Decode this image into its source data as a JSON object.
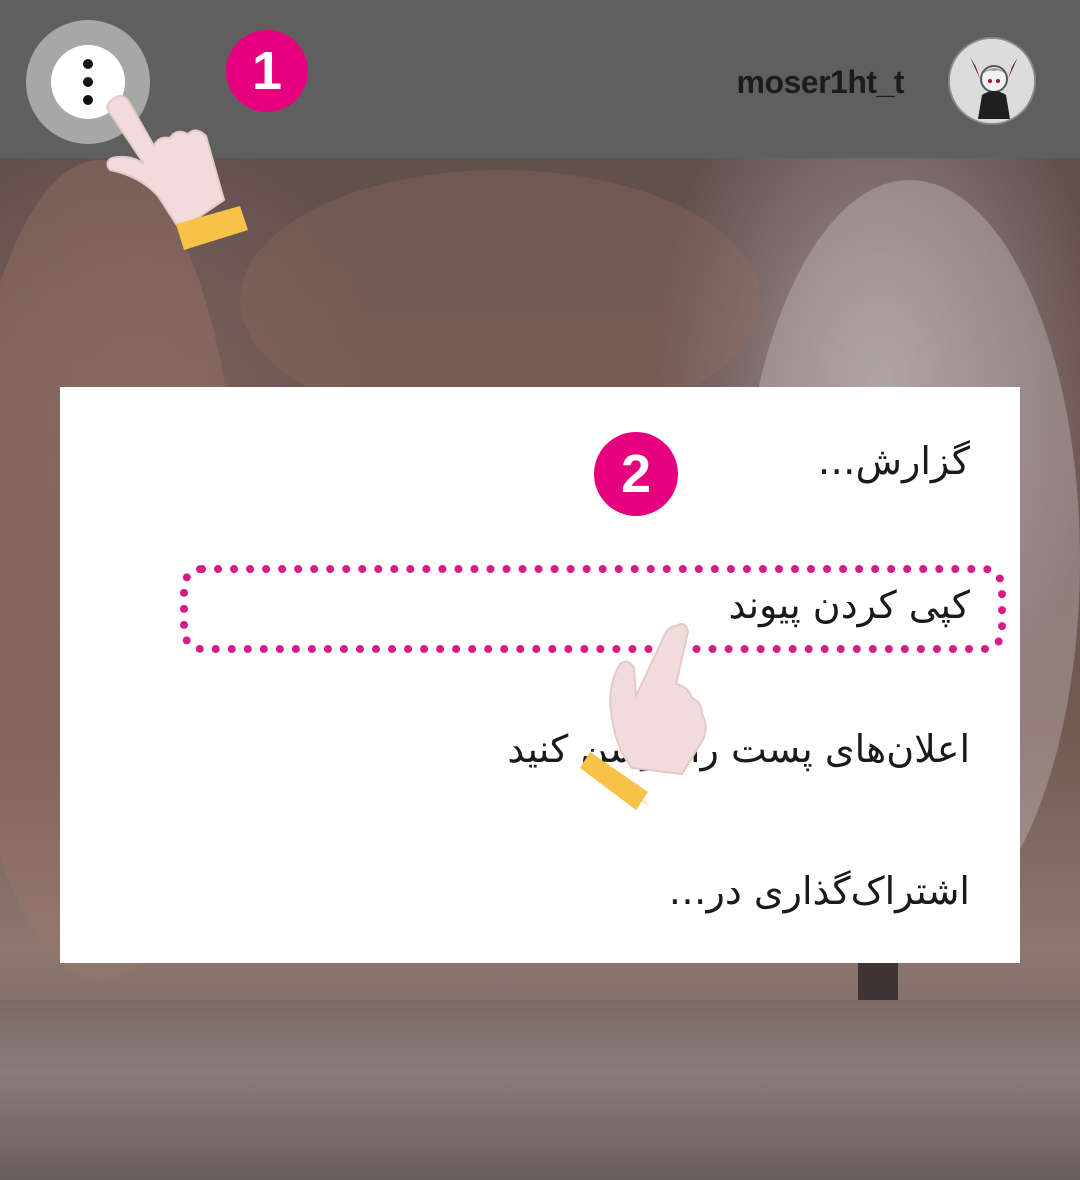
{
  "header": {
    "username": "moser1ht_t",
    "menu_button_icon": "more-vertical-icon",
    "avatar_icon": "profile-avatar-icon"
  },
  "steps": {
    "step1": "1",
    "step2": "2"
  },
  "menu": {
    "items": [
      {
        "label": "گزارش…"
      },
      {
        "label": "کپی کردن پیوند"
      },
      {
        "label": "اعلان‌های پست را روشن کنید"
      },
      {
        "label": "اشتراک‌گذاری در…"
      }
    ]
  },
  "colors": {
    "accent": "#e5007d",
    "highlight": "#d81b8c",
    "topbar": "#5f5f5f",
    "hand_cuff": "#f7c247",
    "hand_skin": "#f0dcda"
  }
}
